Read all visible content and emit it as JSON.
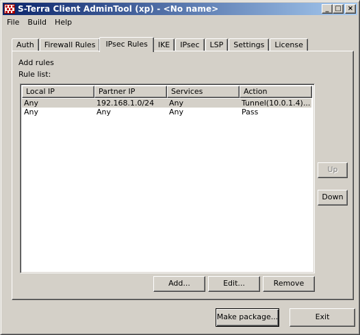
{
  "window": {
    "title": "S-Terra Client AdminTool (xp) - <No name>",
    "controls": {
      "minimize": "_",
      "maximize": "□",
      "close": "×"
    }
  },
  "menu": [
    "File",
    "Build",
    "Help"
  ],
  "tabs": [
    {
      "label": "Auth",
      "active": false
    },
    {
      "label": "Firewall Rules",
      "active": false
    },
    {
      "label": "IPsec Rules",
      "active": true
    },
    {
      "label": "IKE",
      "active": false
    },
    {
      "label": "IPsec",
      "active": false
    },
    {
      "label": "LSP",
      "active": false
    },
    {
      "label": "Settings",
      "active": false
    },
    {
      "label": "License",
      "active": false
    }
  ],
  "panel": {
    "add_rules_label": "Add rules",
    "rule_list_label": "Rule list:",
    "columns": [
      "Local IP",
      "Partner IP",
      "Services",
      "Action"
    ],
    "rows": [
      {
        "local_ip": "Any",
        "partner_ip": "192.168.1.0/24",
        "services": "Any",
        "action": "Tunnel(10.0.1.4)...",
        "selected": true
      },
      {
        "local_ip": "Any",
        "partner_ip": "Any",
        "services": "Any",
        "action": "Pass",
        "selected": false
      }
    ],
    "buttons": {
      "up": "Up",
      "down": "Down",
      "add": "Add...",
      "edit": "Edit...",
      "remove": "Remove"
    }
  },
  "footer": {
    "make_package": "Make package...",
    "exit": "Exit"
  },
  "colors": {
    "face": "#d4d0c8",
    "title_start": "#0a246a",
    "title_end": "#a6caf0",
    "list_bg": "#ffffff",
    "selection": "#d4d0c8"
  }
}
